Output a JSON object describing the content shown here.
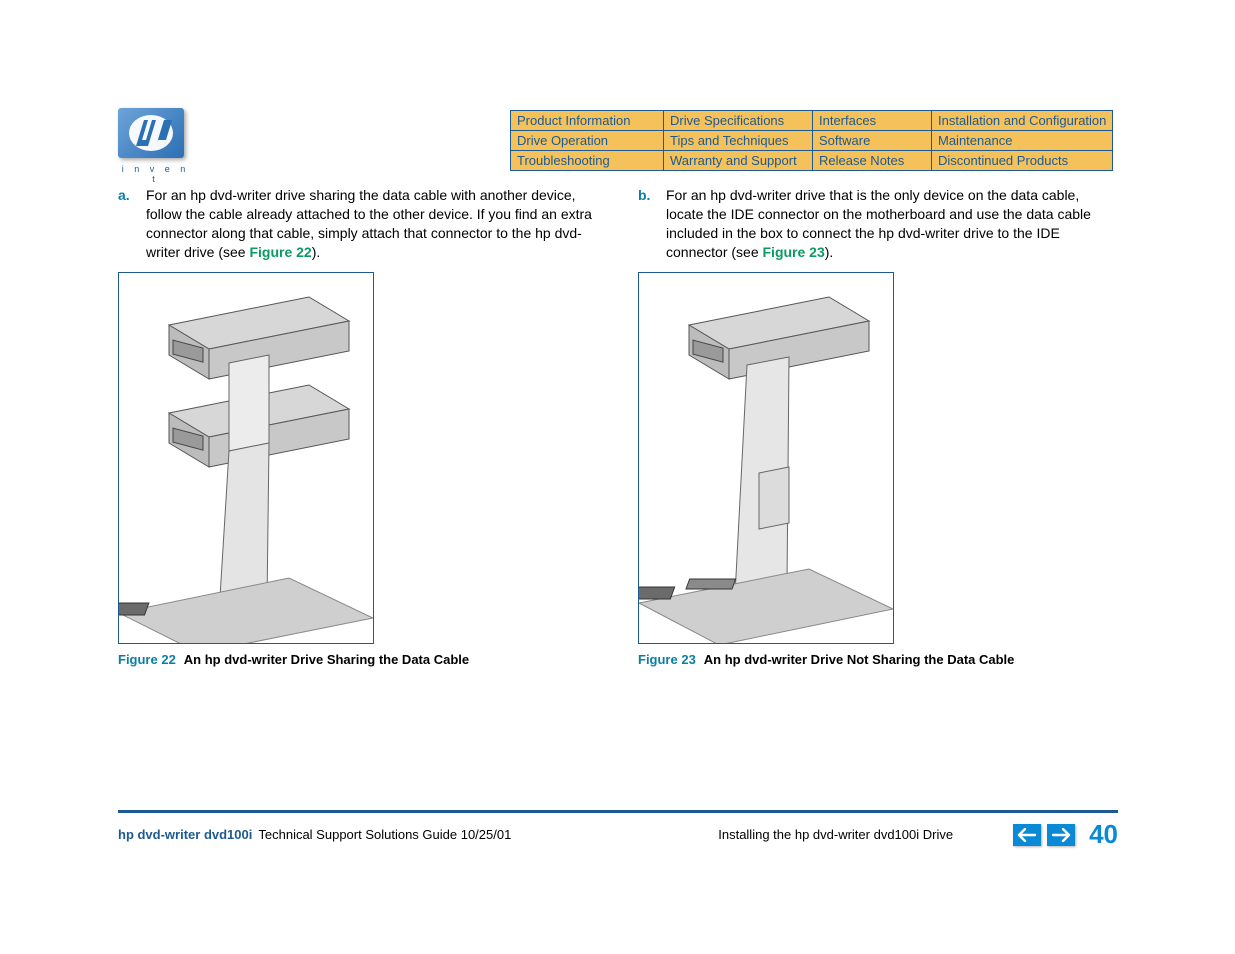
{
  "logo": {
    "tagline": "i n v e n t"
  },
  "nav": {
    "rows": [
      [
        "Product Information",
        "Drive Specifications",
        "Interfaces",
        "Installation and Configuration"
      ],
      [
        "Drive Operation",
        "Tips and Techniques",
        "Software",
        "Maintenance"
      ],
      [
        "Troubleshooting",
        "Warranty and Support",
        "Release Notes",
        "Discontinued Products"
      ]
    ]
  },
  "left": {
    "letter": "a.",
    "text_before": "For an hp dvd-writer drive sharing the data cable with another device, follow the cable already attached to the other device. If you find an extra connector along that cable, simply attach that connector to the hp dvd-writer drive (see ",
    "link": "Figure 22",
    "text_after": ").",
    "fig_num": "Figure 22",
    "fig_title": "An hp dvd-writer Drive Sharing the Data Cable"
  },
  "right": {
    "letter": "b.",
    "text_before": "For an hp dvd-writer drive that is the only device on the data cable, locate the IDE connector on the motherboard and use the data cable included in the box to connect the hp dvd-writer drive to the IDE connector (see ",
    "link": "Figure 23",
    "text_after": ").",
    "fig_num": "Figure 23",
    "fig_title": "An hp dvd-writer Drive Not Sharing the Data Cable"
  },
  "footer": {
    "product": "hp dvd-writer  dvd100i",
    "guide": "Technical Support Solutions Guide 10/25/01",
    "section": "Installing the hp dvd-writer dvd100i Drive",
    "page": "40"
  }
}
